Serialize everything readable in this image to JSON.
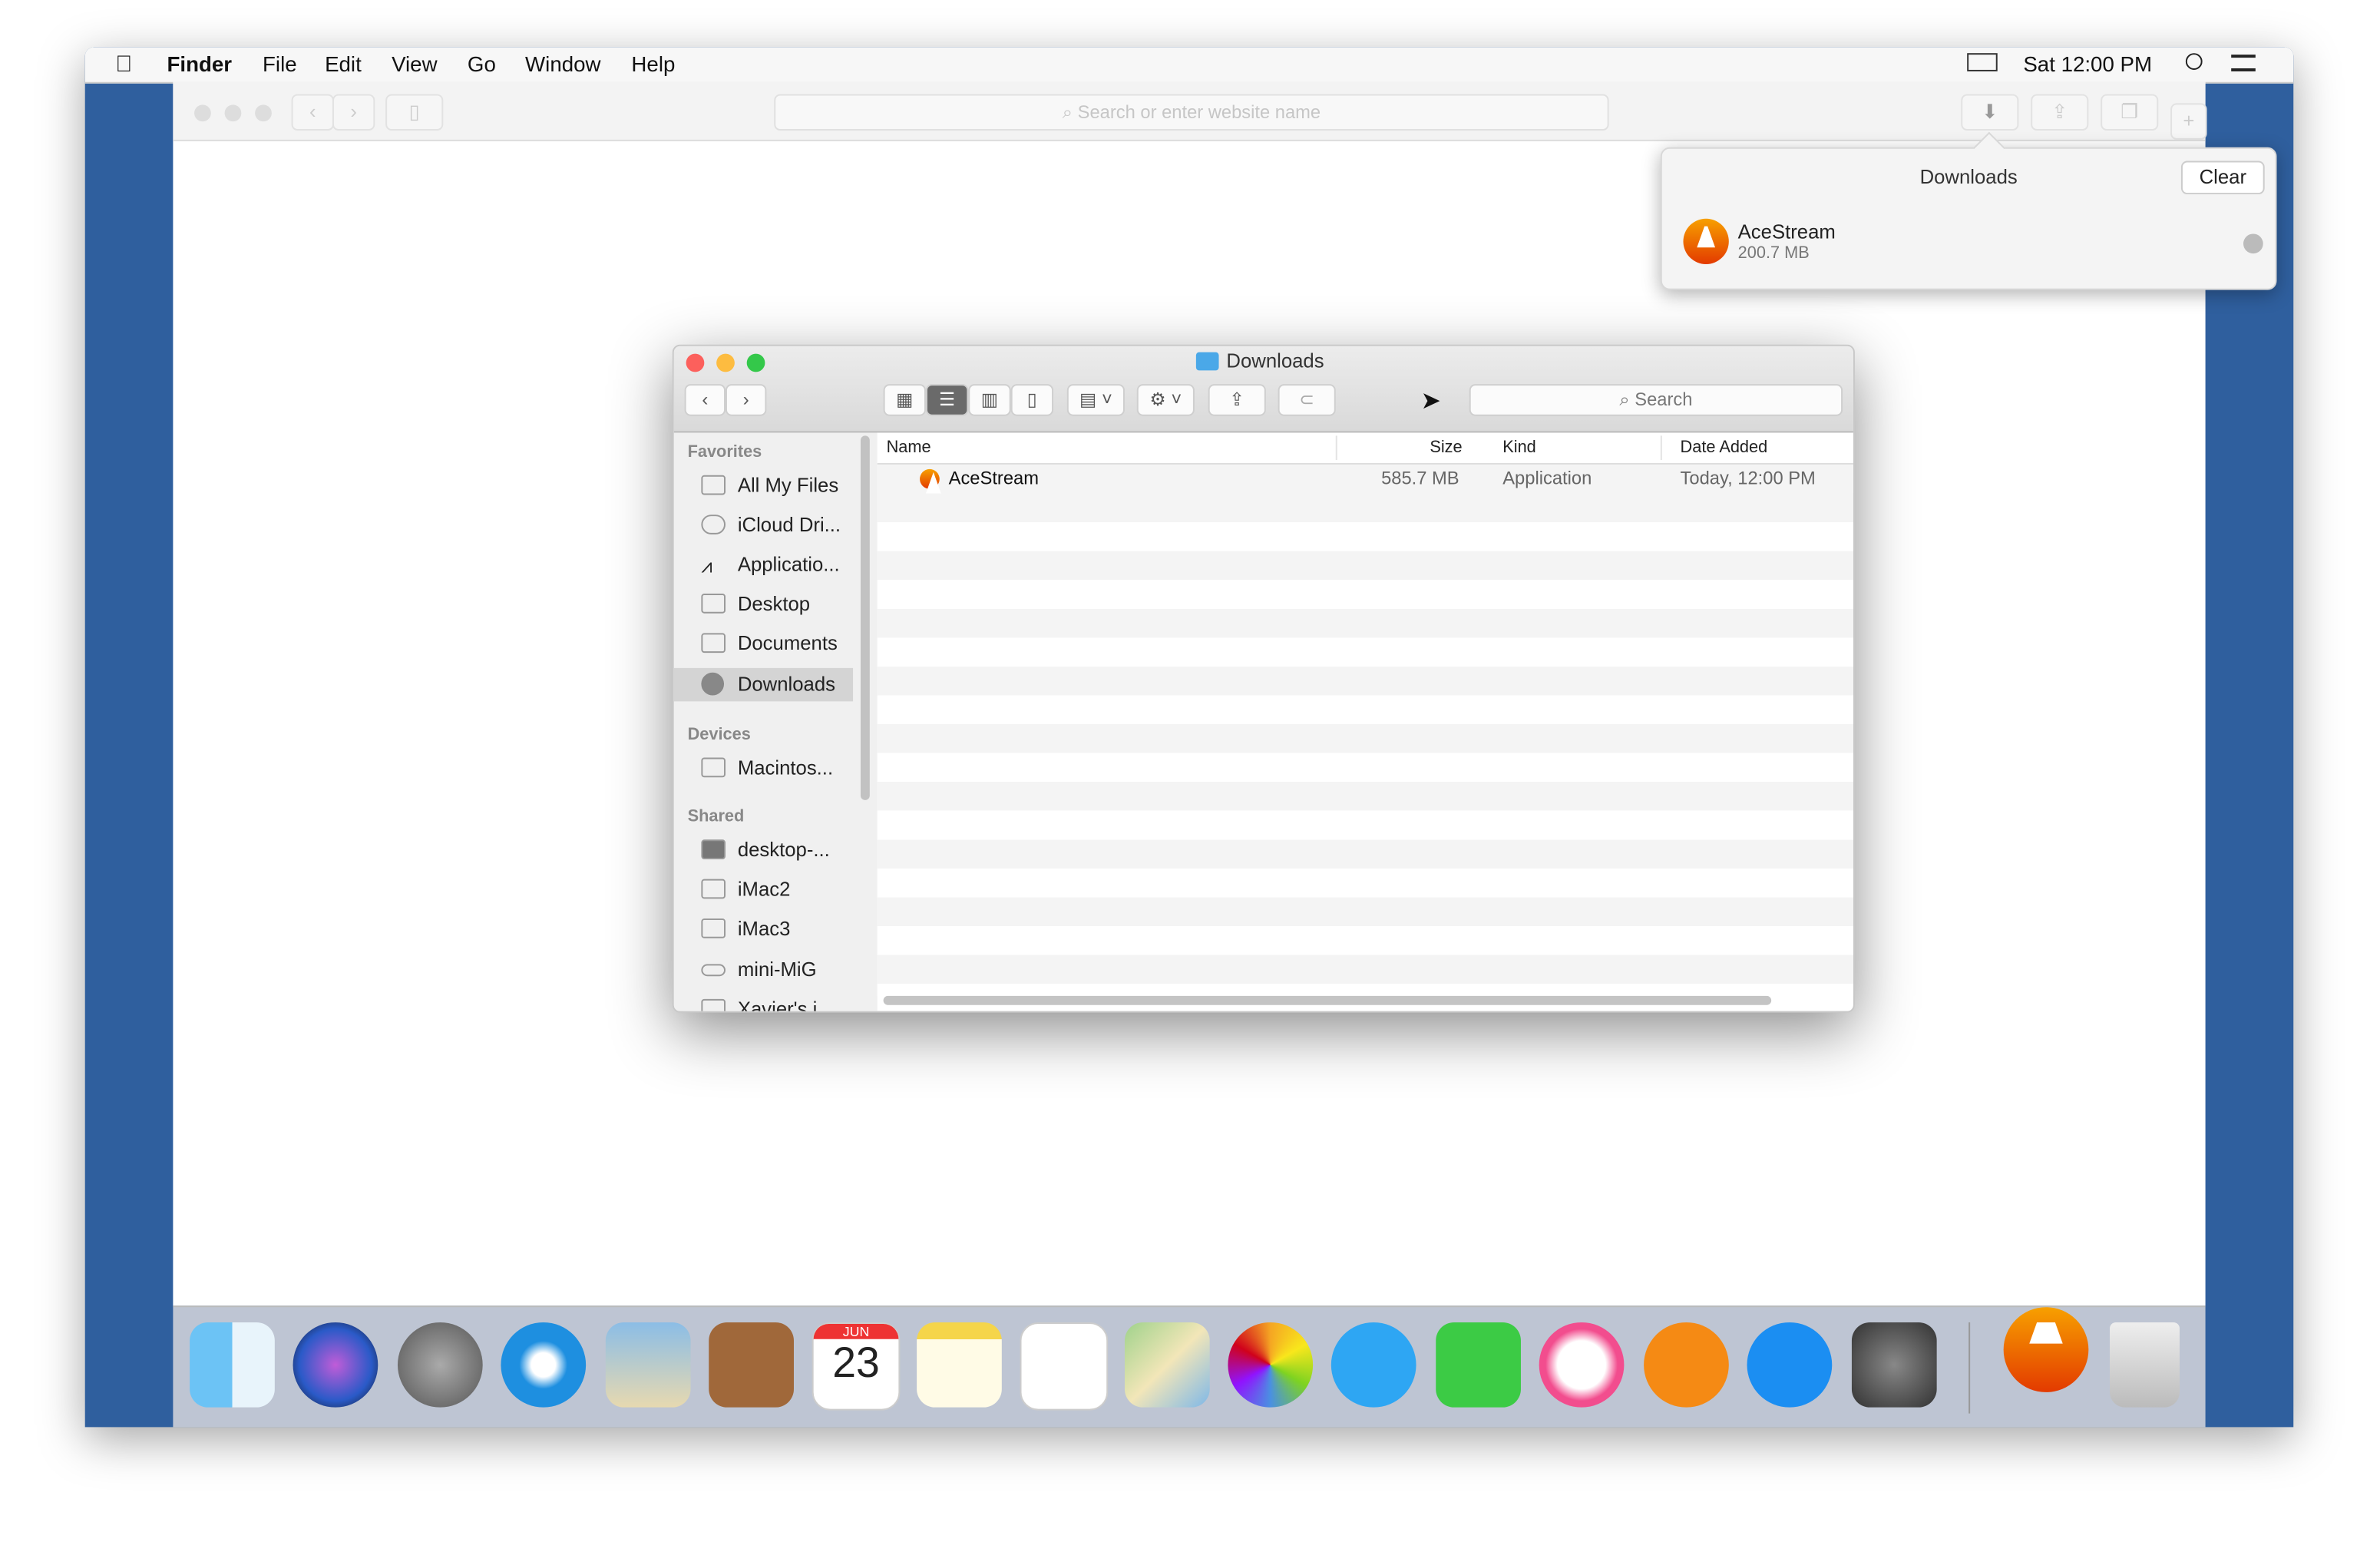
{
  "menubar": {
    "apple": "",
    "items": [
      "Finder",
      "File",
      "Edit",
      "View",
      "Go",
      "Window",
      "Help"
    ],
    "clock": "Sat 12:00 PM"
  },
  "safari": {
    "url_placeholder": "Search or enter website name"
  },
  "downloads_popover": {
    "title": "Downloads",
    "clear_label": "Clear",
    "items": [
      {
        "name": "AceStream",
        "size": "200.7 MB",
        "icon": "vlc-cone-icon"
      }
    ]
  },
  "finder": {
    "title": "Downloads",
    "search_placeholder": "Search",
    "sidebar": {
      "favorites_header": "Favorites",
      "favorites": [
        {
          "label": "All My Files",
          "icon": "all-files-icon"
        },
        {
          "label": "iCloud Dri...",
          "icon": "cloud-icon"
        },
        {
          "label": "Applicatio...",
          "icon": "applications-icon"
        },
        {
          "label": "Desktop",
          "icon": "desktop-icon"
        },
        {
          "label": "Documents",
          "icon": "documents-icon"
        },
        {
          "label": "Downloads",
          "icon": "downloads-icon",
          "selected": true
        }
      ],
      "devices_header": "Devices",
      "devices": [
        {
          "label": "Macintos...",
          "icon": "hard-drive-icon"
        }
      ],
      "shared_header": "Shared",
      "shared": [
        {
          "label": "desktop-...",
          "icon": "pc-icon"
        },
        {
          "label": "iMac2",
          "icon": "imac-icon"
        },
        {
          "label": "iMac3",
          "icon": "imac-icon"
        },
        {
          "label": "mini-MiG",
          "icon": "mac-mini-icon"
        },
        {
          "label": "Xavier's i...",
          "icon": "laptop-icon"
        }
      ]
    },
    "columns": {
      "name": "Name",
      "size": "Size",
      "kind": "Kind",
      "date": "Date Added"
    },
    "files": [
      {
        "name": "AceStream",
        "size": "585.7 MB",
        "kind": "Application",
        "date": "Today, 12:00 PM"
      }
    ]
  },
  "dock": [
    "Finder",
    "Siri",
    "Launchpad",
    "Safari",
    "Mail",
    "Contacts",
    "Calendar",
    "Notes",
    "Reminders",
    "Maps",
    "Photos",
    "Messages",
    "FaceTime",
    "iTunes",
    "iBooks",
    "App Store",
    "System Preferences",
    "AceStream",
    "Trash"
  ],
  "calendar_icon": {
    "month": "JUN",
    "day": "23"
  },
  "colors": {
    "desktop": "#2f5f9e",
    "accent_orange": "#f08a00",
    "close": "#fc605c",
    "minimize": "#fdbc40",
    "zoom": "#34c84a"
  }
}
